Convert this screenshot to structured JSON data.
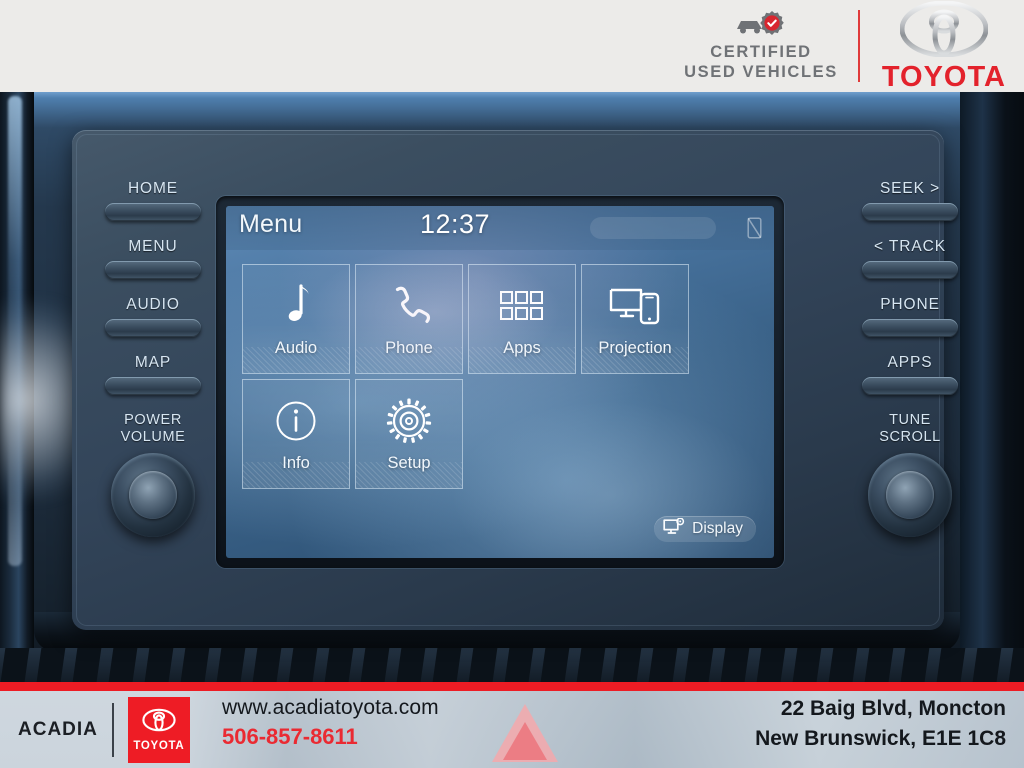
{
  "top_band": {
    "certified_line1": "CERTIFIED",
    "certified_line2": "USED VEHICLES",
    "brand": "TOYOTA",
    "certified_icon": "certified-car-badge-icon",
    "toyota_logo_icon": "toyota-emblem-icon"
  },
  "head_unit": {
    "left_buttons": [
      {
        "label": "HOME",
        "name": "home"
      },
      {
        "label": "MENU",
        "name": "menu"
      },
      {
        "label": "AUDIO",
        "name": "audio"
      },
      {
        "label": "MAP",
        "name": "map"
      }
    ],
    "right_buttons": [
      {
        "label": "SEEK >",
        "name": "seek"
      },
      {
        "label": "< TRACK",
        "name": "track"
      },
      {
        "label": "PHONE",
        "name": "phone"
      },
      {
        "label": "APPS",
        "name": "apps"
      }
    ],
    "left_knob": {
      "line1": "POWER",
      "line2": "VOLUME"
    },
    "right_knob": {
      "line1": "TUNE",
      "line2": "SCROLL"
    }
  },
  "screen": {
    "title": "Menu",
    "clock": "12:37",
    "status_icon": "no-device-slashed-icon",
    "tiles": [
      {
        "label": "Audio",
        "icon": "music-note-icon"
      },
      {
        "label": "Phone",
        "icon": "phone-handset-icon"
      },
      {
        "label": "Apps",
        "icon": "app-grid-icon"
      },
      {
        "label": "Projection",
        "icon": "screen-mirroring-icon"
      },
      {
        "label": "Info",
        "icon": "info-circle-icon"
      },
      {
        "label": "Setup",
        "icon": "gear-icon"
      }
    ],
    "display_button": {
      "label": "Display",
      "icon": "monitor-settings-icon"
    }
  },
  "footer": {
    "dealer_name": "ACADIA",
    "brand_box": "TOYOTA",
    "website": "www.acadiatoyota.com",
    "phone": "506-857-8611",
    "address_line1": "22 Baig Blvd, Moncton",
    "address_line2": "New Brunswick, E1E 1C8"
  },
  "colors": {
    "toyota_red": "#e3222c",
    "footer_red": "#ed1c24",
    "screen_blue": "#47729d",
    "bezel_dark": "#141d27"
  }
}
